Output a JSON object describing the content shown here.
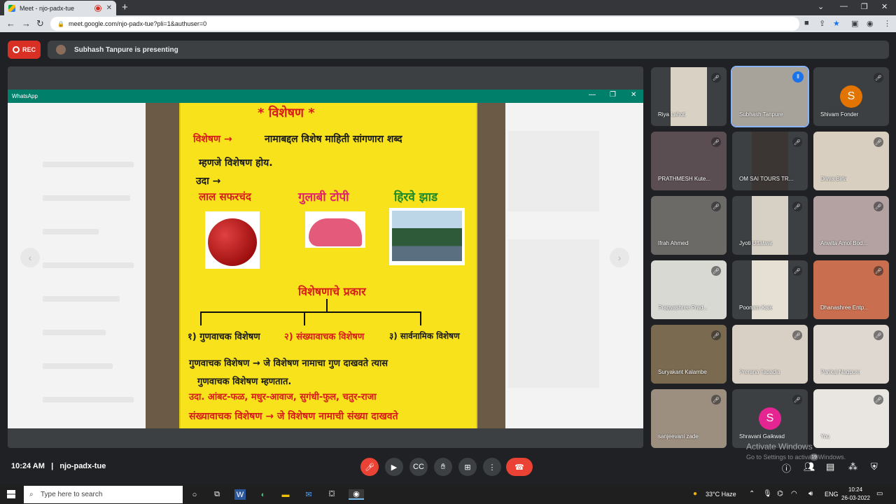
{
  "browser": {
    "tab_title": "Meet - njo-padx-tue",
    "tab_close": "✕",
    "new_tab": "+",
    "url": "meet.google.com/njo-padx-tue?pli=1&authuser=0",
    "window_controls": [
      "⌄",
      "—",
      "❐",
      "✕"
    ]
  },
  "meet_header": {
    "rec_label": "REC",
    "presenter_text": "Subhash Tanpure is presenting"
  },
  "shared_window": {
    "app_title": "WhatsApp",
    "controls": [
      "—",
      "❐",
      "✕"
    ]
  },
  "poster": {
    "title": "* विशेषण *",
    "line1_term": "विशेषण →",
    "line1_def": "नामाबद्दल विशेष माहिती सांगणारा शब्द",
    "line2": "म्हणजे विशेषण होय.",
    "line3": "उदा →",
    "ex_red": "लाल सफरचंद",
    "ex_pink": "गुलाबी टोपी",
    "ex_green": "हिरवे झाड",
    "types_heading": "विशेषणाचे प्रकार",
    "type1": "१) गुणवाचक विशेषण",
    "type2": "२) संख्यावाचक विशेषण",
    "type3": "३) सार्वनामिक विशेषण",
    "def1": "गुणवाचक विशेषण → जे विशेषण नामाचा गुण दाखवते त्यास",
    "def2": "गुणवाचक विशेषण म्हणतात.",
    "def3": "उदा. आंबट-फळ, मधुर-आवाज, सुगंधी-फुल, चतुर-राजा",
    "def4": "संख्यावाचक विशेषण → जे विशेषण नामाची संख्या दाखवते"
  },
  "participants": [
    {
      "name": "Riya Lahoti",
      "muted": true
    },
    {
      "name": "Subhash Tanpure",
      "speaking": true
    },
    {
      "name": "Shivam Fonder",
      "initial": "S",
      "avatar_color": "#e37400",
      "muted": true
    },
    {
      "name": "PRATHMESH Kute...",
      "muted": true
    },
    {
      "name": "OM SAI TOURS TR...",
      "muted": true
    },
    {
      "name": "Divya Birla",
      "muted": true
    },
    {
      "name": "Ifrah Ahmed",
      "muted": true
    },
    {
      "name": "Jyoti Uttalwar",
      "muted": true
    },
    {
      "name": "Anwita Amol Bod...",
      "muted": true
    },
    {
      "name": "Pragyashree Prad...",
      "muted": true
    },
    {
      "name": "Poonam Kale",
      "muted": true
    },
    {
      "name": "Dhanashree Entp...",
      "muted": true
    },
    {
      "name": "Suryakant Kalambe",
      "muted": true
    },
    {
      "name": "Prerana Tapadia",
      "muted": true
    },
    {
      "name": "Pankaj Nagpure",
      "muted": true
    },
    {
      "name": "sanjeevani zade",
      "muted": true
    },
    {
      "name": "Shravani Gaikwad",
      "initial": "S",
      "avatar_color": "#e52592",
      "muted": true
    },
    {
      "name": "You",
      "muted": true
    }
  ],
  "bottom_bar": {
    "time": "10:24 AM",
    "separator": "|",
    "meeting_code": "njo-padx-tue",
    "people_count": "19"
  },
  "windows_activation": {
    "line1": "Activate Windows",
    "line2": "Go to Settings to activate Windows."
  },
  "taskbar": {
    "search_placeholder": "Type here to search",
    "weather": "33°C  Haze",
    "language": "ENG",
    "time": "10:24",
    "date": "26-03-2022"
  },
  "colors": {
    "meet_bg": "#202124",
    "tile_bg": "#3c4043",
    "rec_red": "#d93025",
    "whatsapp_green": "#00806b",
    "poster_yellow": "#f7e21b",
    "accent_blue": "#8ab4f8"
  }
}
